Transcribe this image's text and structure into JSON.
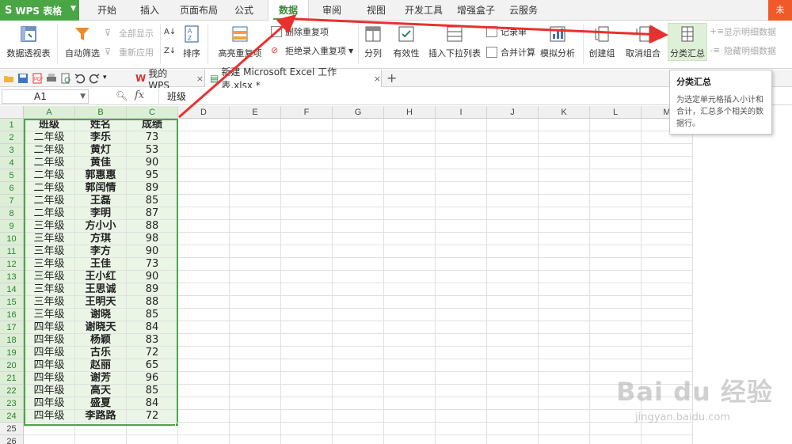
{
  "app": {
    "name": "WPS 表格",
    "logo": "S"
  },
  "menu": {
    "tabs": [
      "开始",
      "插入",
      "页面布局",
      "公式",
      "数据",
      "审阅",
      "视图",
      "开发工具",
      "增强盒子",
      "云服务"
    ],
    "active": "数据",
    "login": "未"
  },
  "ribbon": {
    "pivot": "数据透视表",
    "autofilter": "自动筛选",
    "show_all": "全部显示",
    "reapply": "重新应用",
    "sort": "排序",
    "highlight_dup": "高亮重复项",
    "delete_dup": "删除重复项",
    "reject_dup": "拒绝录入重复项",
    "text_to_cols": "分列",
    "validation": "有效性",
    "insert_dropdown": "插入下拉列表",
    "record": "记录单",
    "consolidate": "合并计算",
    "simulation": "模拟分析",
    "group": "创建组",
    "ungroup": "取消组合",
    "subtotal": "分类汇总",
    "show_detail": "显示明细数据",
    "hide_detail": "隐藏明细数据"
  },
  "quickbar": {
    "tabs": [
      {
        "label": "我的WPS",
        "close": "×"
      },
      {
        "label": "新建 Microsoft Excel 工作表.xlsx *",
        "close": "×"
      }
    ],
    "add": "+"
  },
  "formula_bar": {
    "name_box": "A1",
    "fx": "fx",
    "value": "班级"
  },
  "tooltip": {
    "title": "分类汇总",
    "body": "为选定单元格插入小计和合计，汇总多个相关的数据行。"
  },
  "columns": [
    "A",
    "B",
    "C",
    "D",
    "E",
    "F",
    "G",
    "H",
    "I",
    "J",
    "K",
    "L",
    "M"
  ],
  "rows": [
    [
      "班级",
      "姓名",
      "成绩"
    ],
    [
      "二年级",
      "李乐",
      "73"
    ],
    [
      "二年级",
      "黄灯",
      "53"
    ],
    [
      "二年级",
      "黄佳",
      "90"
    ],
    [
      "二年级",
      "郭惠惠",
      "95"
    ],
    [
      "二年级",
      "郭闰情",
      "89"
    ],
    [
      "二年级",
      "王磊",
      "85"
    ],
    [
      "二年级",
      "李明",
      "87"
    ],
    [
      "三年级",
      "方小小",
      "88"
    ],
    [
      "三年级",
      "方琪",
      "98"
    ],
    [
      "三年级",
      "李方",
      "90"
    ],
    [
      "三年级",
      "王佳",
      "73"
    ],
    [
      "三年级",
      "王小红",
      "90"
    ],
    [
      "三年级",
      "王思诚",
      "89"
    ],
    [
      "三年级",
      "王明天",
      "88"
    ],
    [
      "三年级",
      "谢晓",
      "85"
    ],
    [
      "四年级",
      "谢晓天",
      "84"
    ],
    [
      "四年级",
      "杨颖",
      "83"
    ],
    [
      "四年级",
      "古乐",
      "72"
    ],
    [
      "四年级",
      "赵丽",
      "65"
    ],
    [
      "四年级",
      "谢芳",
      "96"
    ],
    [
      "四年级",
      "高天",
      "85"
    ],
    [
      "四年级",
      "盛夏",
      "84"
    ],
    [
      "四年级",
      "李路路",
      "72"
    ],
    [
      "",
      "",
      ""
    ],
    [
      "",
      "",
      ""
    ]
  ],
  "watermark": {
    "text": "Bai du 经验",
    "sub": "jingyan.baidu.com"
  },
  "colors": {
    "accent": "#4aa645",
    "arrow": "#e8312f",
    "selection": "#eaf5e6"
  }
}
